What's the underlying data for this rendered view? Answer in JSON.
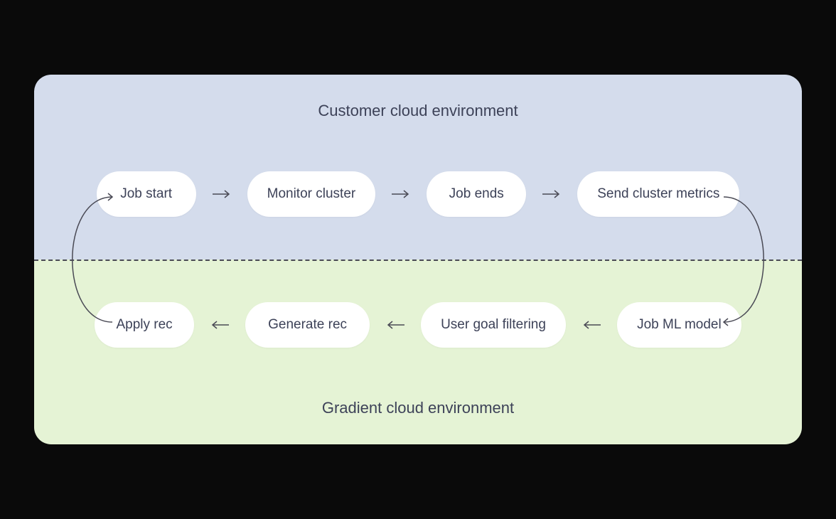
{
  "sections": {
    "top": {
      "title": "Customer cloud environment",
      "nodes": [
        {
          "label": "Job start"
        },
        {
          "label": "Monitor cluster"
        },
        {
          "label": "Job ends"
        },
        {
          "label": "Send cluster metrics"
        }
      ]
    },
    "bottom": {
      "title": "Gradient cloud environment",
      "nodes": [
        {
          "label": "Apply rec"
        },
        {
          "label": "Generate rec"
        },
        {
          "label": "User goal filtering"
        },
        {
          "label": "Job ML model"
        }
      ]
    }
  },
  "flow": {
    "direction_top": "left_to_right",
    "direction_bottom": "right_to_left",
    "loop": true
  },
  "colors": {
    "background": "#0a0a0a",
    "top_section": "#d4dcec",
    "bottom_section": "#e5f3d5",
    "node_bg": "#ffffff",
    "text": "#3d4258",
    "arrow": "#4a4a55"
  }
}
